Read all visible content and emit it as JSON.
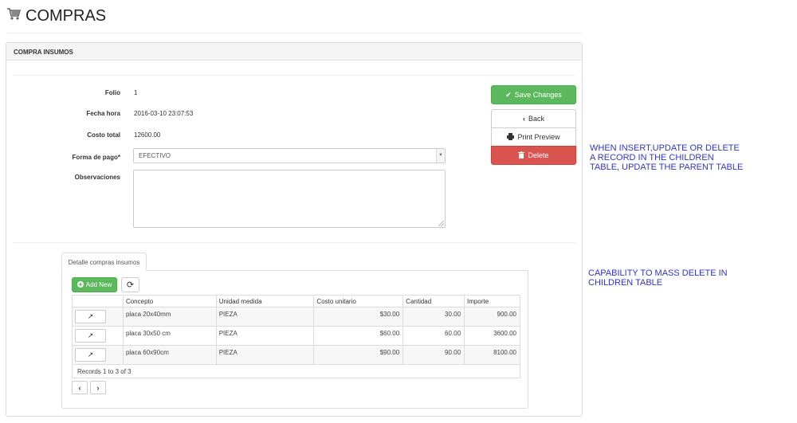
{
  "page": {
    "title": "COMPRAS",
    "icon": "shopping-cart-icon"
  },
  "panel": {
    "heading": "COMPRA INSUMOS",
    "fields": {
      "folio_label": "Folio",
      "folio_value": "1",
      "fecha_label": "Fecha hora",
      "fecha_value": "2016-03-10 23:07:53",
      "costo_label": "Costo total",
      "costo_value": "12600.00",
      "forma_label": "Forma de pago*",
      "forma_value": "EFECTIVO",
      "obs_label": "Observaciones",
      "obs_value": ""
    },
    "buttons": {
      "save": "Save Changes",
      "back": "Back",
      "print": "Print Preview",
      "delete": "Delete"
    }
  },
  "subgrid": {
    "tab_label": "Detalle compras insumos",
    "add_new": "Add New",
    "columns": [
      "Concepto",
      "Unidad medida",
      "Costo unitario",
      "Cantidad",
      "Importe"
    ],
    "rows": [
      {
        "concepto": "placa 20x40mm",
        "unidad": "PIEZA",
        "costo": "$30.00",
        "cantidad": "30.00",
        "importe": "900.00"
      },
      {
        "concepto": "placa 30x50 cm",
        "unidad": "PIEZA",
        "costo": "$60.00",
        "cantidad": "60.00",
        "importe": "3600.00"
      },
      {
        "concepto": "placa 60x90cm",
        "unidad": "PIEZA",
        "costo": "$90.00",
        "cantidad": "90.00",
        "importe": "8100.00"
      }
    ],
    "records_text": "Records 1 to 3 of 3"
  },
  "annotations": {
    "note1_line1": "WHEN INSERT,UPDATE OR DELETE",
    "note1_line2": "A RECORD IN THE CHILDREN",
    "note1_line3": "TABLE, UPDATE THE PARENT TABLE",
    "note2_line1": "CAPABILITY TO MASS DELETE IN",
    "note2_line2": "CHILDREN TABLE"
  },
  "colors": {
    "success": "#5cb85c",
    "danger": "#d9534f",
    "annotation": "#3333cc"
  }
}
